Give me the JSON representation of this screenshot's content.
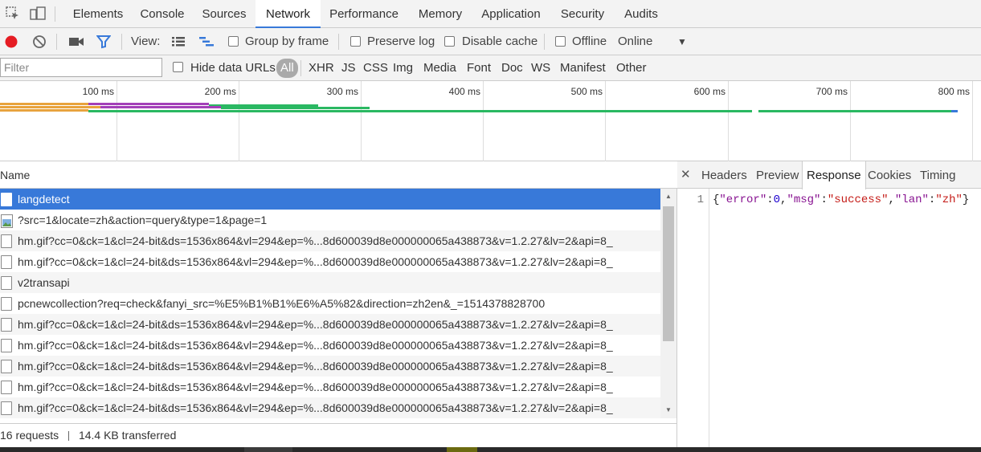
{
  "tabs": [
    "Elements",
    "Console",
    "Sources",
    "Network",
    "Performance",
    "Memory",
    "Application",
    "Security",
    "Audits"
  ],
  "active_tab": "Network",
  "toolbar": {
    "view_label": "View:",
    "group_by_frame": "Group by frame",
    "preserve_log": "Preserve log",
    "disable_cache": "Disable cache",
    "offline": "Offline",
    "throttle": "Online",
    "record_color": "#e51c23",
    "filter_icon_color": "#3879d9"
  },
  "filter": {
    "placeholder": "Filter",
    "hide_data_urls": "Hide data URLs",
    "types": [
      "All",
      "XHR",
      "JS",
      "CSS",
      "Img",
      "Media",
      "Font",
      "Doc",
      "WS",
      "Manifest",
      "Other"
    ],
    "active_type": "All"
  },
  "overview": {
    "ticks": [
      "100 ms",
      "200 ms",
      "300 ms",
      "400 ms",
      "500 ms",
      "600 ms",
      "700 ms",
      "800 ms"
    ]
  },
  "requests": {
    "header": "Name",
    "rows": [
      {
        "name": "langdetect",
        "icon": "document-icon"
      },
      {
        "name": "?src=1&locate=zh&action=query&type=1&page=1",
        "icon": "image-icon"
      },
      {
        "name": "hm.gif?cc=0&ck=1&cl=24-bit&ds=1536x864&vl=294&ep=%...8d600039d8e000000065a438873&v=1.2.27&lv=2&api=8_",
        "icon": "document-icon"
      },
      {
        "name": "hm.gif?cc=0&ck=1&cl=24-bit&ds=1536x864&vl=294&ep=%...8d600039d8e000000065a438873&v=1.2.27&lv=2&api=8_",
        "icon": "document-icon"
      },
      {
        "name": "v2transapi",
        "icon": "document-icon"
      },
      {
        "name": "pcnewcollection?req=check&fanyi_src=%E5%B1%B1%E6%A5%82&direction=zh2en&_=1514378828700",
        "icon": "document-icon"
      },
      {
        "name": "hm.gif?cc=0&ck=1&cl=24-bit&ds=1536x864&vl=294&ep=%...8d600039d8e000000065a438873&v=1.2.27&lv=2&api=8_",
        "icon": "document-icon"
      },
      {
        "name": "hm.gif?cc=0&ck=1&cl=24-bit&ds=1536x864&vl=294&ep=%...8d600039d8e000000065a438873&v=1.2.27&lv=2&api=8_",
        "icon": "document-icon"
      },
      {
        "name": "hm.gif?cc=0&ck=1&cl=24-bit&ds=1536x864&vl=294&ep=%...8d600039d8e000000065a438873&v=1.2.27&lv=2&api=8_",
        "icon": "document-icon"
      },
      {
        "name": "hm.gif?cc=0&ck=1&cl=24-bit&ds=1536x864&vl=294&ep=%...8d600039d8e000000065a438873&v=1.2.27&lv=2&api=8_",
        "icon": "document-icon"
      },
      {
        "name": "hm.gif?cc=0&ck=1&cl=24-bit&ds=1536x864&vl=294&ep=%...8d600039d8e000000065a438873&v=1.2.27&lv=2&api=8_",
        "icon": "document-icon"
      }
    ],
    "selected_index": 0,
    "status_requests": "16 requests",
    "status_transferred": "14.4 KB transferred"
  },
  "details": {
    "tabs": [
      "Headers",
      "Preview",
      "Response",
      "Cookies",
      "Timing"
    ],
    "active_tab": "Response",
    "line_number": "1",
    "response_text": "{\"error\":0,\"msg\":\"success\",\"lan\":\"zh\"}"
  }
}
